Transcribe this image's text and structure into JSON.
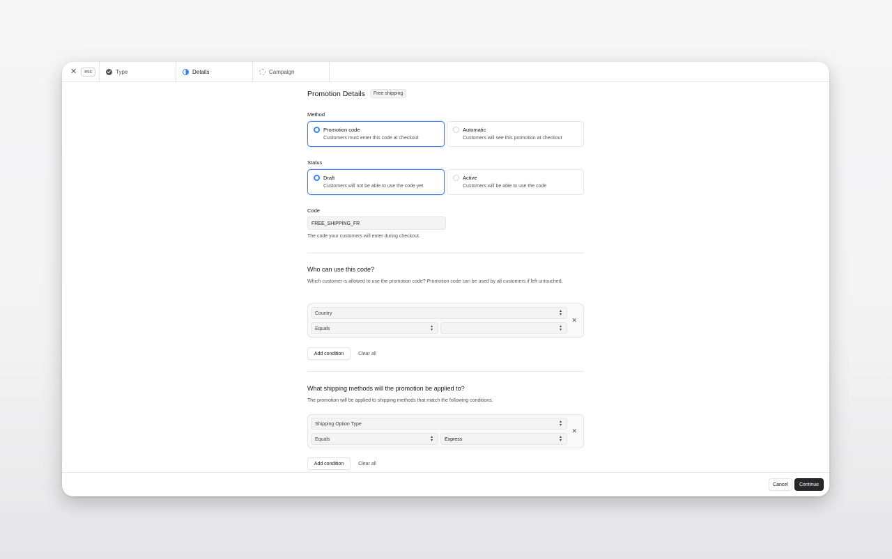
{
  "topbar": {
    "esc_label": "esc",
    "steps": [
      {
        "label": "Type",
        "state": "done"
      },
      {
        "label": "Details",
        "state": "in-progress"
      },
      {
        "label": "Campaign",
        "state": "pending"
      }
    ]
  },
  "header": {
    "title": "Promotion Details",
    "badge": "Free shipping"
  },
  "method": {
    "label": "Method",
    "options": [
      {
        "title": "Promotion code",
        "desc": "Customers must enter this code at checkout",
        "selected": true
      },
      {
        "title": "Automatic",
        "desc": "Customers will see this promotion at checkout",
        "selected": false
      }
    ]
  },
  "status": {
    "label": "Status",
    "options": [
      {
        "title": "Draft",
        "desc": "Customers will not be able to use the code yet",
        "selected": true
      },
      {
        "title": "Active",
        "desc": "Customers will be able to use the code",
        "selected": false
      }
    ]
  },
  "code": {
    "label": "Code",
    "value": "FREE_SHIPPING_FR",
    "hint": "The code your customers will enter during checkout."
  },
  "who": {
    "title": "Who can use this code?",
    "desc": "Which customer is allowed to use the promotion code? Promotion code can be used by all customers if left untouched.",
    "condition": {
      "attribute": "Country",
      "operator": "Equals",
      "value": ""
    },
    "add_label": "Add condition",
    "clear_label": "Clear all"
  },
  "shipping": {
    "title": "What shipping methods will the promotion be applied to?",
    "desc": "The promotion will be applied to shipping methods that match the following conditions.",
    "condition": {
      "attribute": "Shipping Option Type",
      "operator": "Equals",
      "value": "Express"
    },
    "add_label": "Add condition",
    "clear_label": "Clear all"
  },
  "footer": {
    "cancel_label": "Cancel",
    "continue_label": "Continue"
  },
  "colors": {
    "accent": "#3b82f6",
    "primary_button": "#27272a",
    "border": "#e4e4e7"
  }
}
